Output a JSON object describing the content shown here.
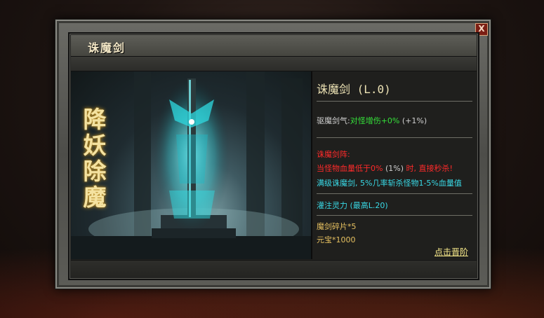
{
  "window": {
    "title": "诛魔剑",
    "close_label": "X"
  },
  "art": {
    "vertical_text": [
      "降",
      "妖",
      "除",
      "魔"
    ]
  },
  "info": {
    "name": "诛魔剑 (L.0)",
    "attr_label": "驱魔剑气:",
    "attr_value": "对怪增伤+0%",
    "attr_next": " (+1%)",
    "skill_title": "诛魔剑阵:",
    "skill_line1_a": "当怪物血量低于0%",
    "skill_line1_b": " (1%) ",
    "skill_line1_c": "时, 直接秒杀!",
    "skill_line2": "满级诛魔剑, 5%几率斩杀怪物1-5%血量值",
    "inject": "灌注灵力 (最高L.20)",
    "cost1": "魔剑碎片*5",
    "cost2": "元宝*1000",
    "upgrade_label": "点击晋阶"
  },
  "colors": {
    "green": "#35e23a",
    "red": "#ff2a2a",
    "cyan": "#39d9e6",
    "gold": "#e6c060"
  }
}
